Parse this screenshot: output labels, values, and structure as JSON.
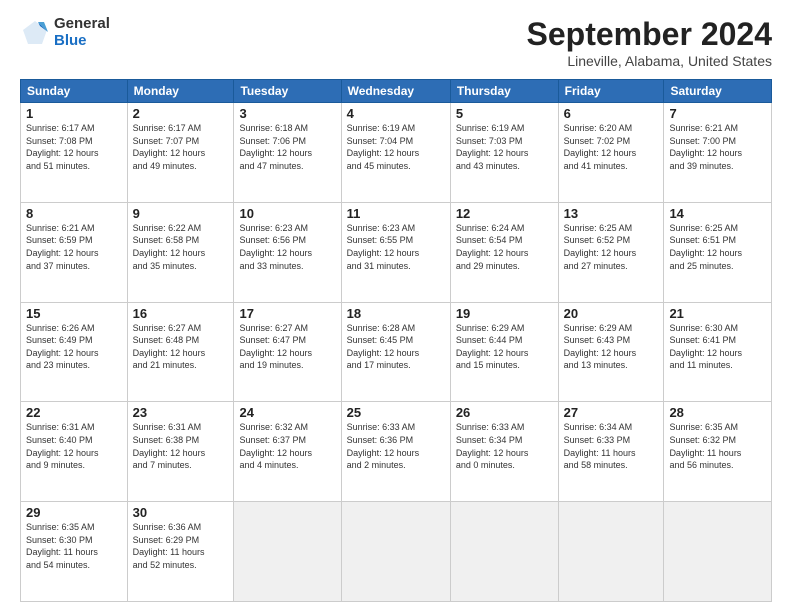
{
  "logo": {
    "general": "General",
    "blue": "Blue"
  },
  "title": "September 2024",
  "subtitle": "Lineville, Alabama, United States",
  "headers": [
    "Sunday",
    "Monday",
    "Tuesday",
    "Wednesday",
    "Thursday",
    "Friday",
    "Saturday"
  ],
  "weeks": [
    [
      {
        "day": "1",
        "info": "Sunrise: 6:17 AM\nSunset: 7:08 PM\nDaylight: 12 hours\nand 51 minutes."
      },
      {
        "day": "2",
        "info": "Sunrise: 6:17 AM\nSunset: 7:07 PM\nDaylight: 12 hours\nand 49 minutes."
      },
      {
        "day": "3",
        "info": "Sunrise: 6:18 AM\nSunset: 7:06 PM\nDaylight: 12 hours\nand 47 minutes."
      },
      {
        "day": "4",
        "info": "Sunrise: 6:19 AM\nSunset: 7:04 PM\nDaylight: 12 hours\nand 45 minutes."
      },
      {
        "day": "5",
        "info": "Sunrise: 6:19 AM\nSunset: 7:03 PM\nDaylight: 12 hours\nand 43 minutes."
      },
      {
        "day": "6",
        "info": "Sunrise: 6:20 AM\nSunset: 7:02 PM\nDaylight: 12 hours\nand 41 minutes."
      },
      {
        "day": "7",
        "info": "Sunrise: 6:21 AM\nSunset: 7:00 PM\nDaylight: 12 hours\nand 39 minutes."
      }
    ],
    [
      {
        "day": "8",
        "info": "Sunrise: 6:21 AM\nSunset: 6:59 PM\nDaylight: 12 hours\nand 37 minutes."
      },
      {
        "day": "9",
        "info": "Sunrise: 6:22 AM\nSunset: 6:58 PM\nDaylight: 12 hours\nand 35 minutes."
      },
      {
        "day": "10",
        "info": "Sunrise: 6:23 AM\nSunset: 6:56 PM\nDaylight: 12 hours\nand 33 minutes."
      },
      {
        "day": "11",
        "info": "Sunrise: 6:23 AM\nSunset: 6:55 PM\nDaylight: 12 hours\nand 31 minutes."
      },
      {
        "day": "12",
        "info": "Sunrise: 6:24 AM\nSunset: 6:54 PM\nDaylight: 12 hours\nand 29 minutes."
      },
      {
        "day": "13",
        "info": "Sunrise: 6:25 AM\nSunset: 6:52 PM\nDaylight: 12 hours\nand 27 minutes."
      },
      {
        "day": "14",
        "info": "Sunrise: 6:25 AM\nSunset: 6:51 PM\nDaylight: 12 hours\nand 25 minutes."
      }
    ],
    [
      {
        "day": "15",
        "info": "Sunrise: 6:26 AM\nSunset: 6:49 PM\nDaylight: 12 hours\nand 23 minutes."
      },
      {
        "day": "16",
        "info": "Sunrise: 6:27 AM\nSunset: 6:48 PM\nDaylight: 12 hours\nand 21 minutes."
      },
      {
        "day": "17",
        "info": "Sunrise: 6:27 AM\nSunset: 6:47 PM\nDaylight: 12 hours\nand 19 minutes."
      },
      {
        "day": "18",
        "info": "Sunrise: 6:28 AM\nSunset: 6:45 PM\nDaylight: 12 hours\nand 17 minutes."
      },
      {
        "day": "19",
        "info": "Sunrise: 6:29 AM\nSunset: 6:44 PM\nDaylight: 12 hours\nand 15 minutes."
      },
      {
        "day": "20",
        "info": "Sunrise: 6:29 AM\nSunset: 6:43 PM\nDaylight: 12 hours\nand 13 minutes."
      },
      {
        "day": "21",
        "info": "Sunrise: 6:30 AM\nSunset: 6:41 PM\nDaylight: 12 hours\nand 11 minutes."
      }
    ],
    [
      {
        "day": "22",
        "info": "Sunrise: 6:31 AM\nSunset: 6:40 PM\nDaylight: 12 hours\nand 9 minutes."
      },
      {
        "day": "23",
        "info": "Sunrise: 6:31 AM\nSunset: 6:38 PM\nDaylight: 12 hours\nand 7 minutes."
      },
      {
        "day": "24",
        "info": "Sunrise: 6:32 AM\nSunset: 6:37 PM\nDaylight: 12 hours\nand 4 minutes."
      },
      {
        "day": "25",
        "info": "Sunrise: 6:33 AM\nSunset: 6:36 PM\nDaylight: 12 hours\nand 2 minutes."
      },
      {
        "day": "26",
        "info": "Sunrise: 6:33 AM\nSunset: 6:34 PM\nDaylight: 12 hours\nand 0 minutes."
      },
      {
        "day": "27",
        "info": "Sunrise: 6:34 AM\nSunset: 6:33 PM\nDaylight: 11 hours\nand 58 minutes."
      },
      {
        "day": "28",
        "info": "Sunrise: 6:35 AM\nSunset: 6:32 PM\nDaylight: 11 hours\nand 56 minutes."
      }
    ],
    [
      {
        "day": "29",
        "info": "Sunrise: 6:35 AM\nSunset: 6:30 PM\nDaylight: 11 hours\nand 54 minutes."
      },
      {
        "day": "30",
        "info": "Sunrise: 6:36 AM\nSunset: 6:29 PM\nDaylight: 11 hours\nand 52 minutes."
      },
      {
        "day": "",
        "info": ""
      },
      {
        "day": "",
        "info": ""
      },
      {
        "day": "",
        "info": ""
      },
      {
        "day": "",
        "info": ""
      },
      {
        "day": "",
        "info": ""
      }
    ]
  ]
}
